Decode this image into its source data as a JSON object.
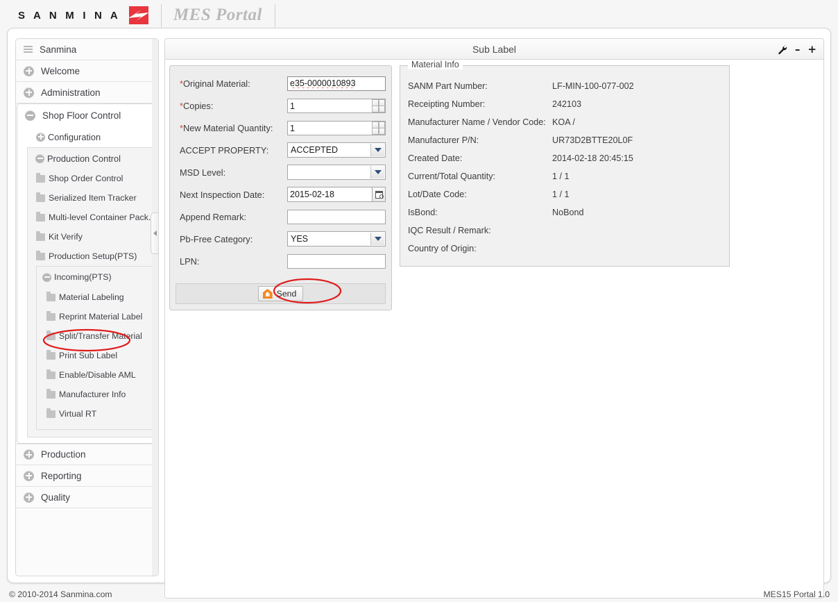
{
  "brand": {
    "word": "S A N M I N A",
    "logo_icon": "sanmina-bolt-logo",
    "logo_color": "#e8353e",
    "portal_title": "MES Portal"
  },
  "sidebar": {
    "top_items": [
      {
        "label": "Sanmina",
        "icon": "list-icon",
        "state": "static"
      },
      {
        "label": "Welcome",
        "icon": "plus-circle-icon",
        "state": "collapsed"
      },
      {
        "label": "Administration",
        "icon": "plus-circle-icon",
        "state": "collapsed"
      }
    ],
    "shop_floor_control": {
      "label": "Shop Floor Control",
      "icon": "minus-circle-icon",
      "state": "expanded",
      "configuration": {
        "label": "Configuration",
        "icon": "plus-circle-icon",
        "state": "collapsed"
      },
      "production_control": {
        "label": "Production Control",
        "icon": "minus-circle-icon",
        "state": "expanded",
        "items": [
          {
            "label": "Shop Order Control",
            "icon": "folder-icon"
          },
          {
            "label": "Serialized Item Tracker",
            "icon": "folder-icon"
          },
          {
            "label": "Multi-level Container Pack.",
            "icon": "folder-icon"
          },
          {
            "label": "Kit Verify",
            "icon": "folder-icon"
          },
          {
            "label": "Production Setup(PTS)",
            "icon": "folder-icon"
          }
        ],
        "incoming": {
          "label": "Incoming(PTS)",
          "icon": "minus-circle-icon",
          "state": "expanded",
          "items": [
            {
              "label": "Material Labeling",
              "icon": "folder-icon",
              "highlighted": false
            },
            {
              "label": "Reprint Material Label",
              "icon": "folder-icon",
              "highlighted": false
            },
            {
              "label": "Split/Transfer Material",
              "icon": "folder-icon",
              "highlighted": false
            },
            {
              "label": "Print Sub Label",
              "icon": "folder-icon",
              "highlighted": true
            },
            {
              "label": "Enable/Disable AML",
              "icon": "folder-icon",
              "highlighted": false
            },
            {
              "label": "Manufacturer Info",
              "icon": "folder-icon",
              "highlighted": false
            },
            {
              "label": "Virtual RT",
              "icon": "folder-icon",
              "highlighted": false
            }
          ]
        }
      }
    },
    "bottom_items": [
      {
        "label": "Production",
        "icon": "plus-circle-icon",
        "state": "collapsed"
      },
      {
        "label": "Reporting",
        "icon": "plus-circle-icon",
        "state": "collapsed"
      },
      {
        "label": "Quality",
        "icon": "plus-circle-icon",
        "state": "collapsed"
      }
    ],
    "collapse_handle_icon": "chevron-left-icon"
  },
  "content": {
    "title": "Sub Label",
    "tools": [
      {
        "name": "wrench-icon",
        "glyph": "\u0001"
      },
      {
        "name": "minimize-icon",
        "glyph": "–"
      },
      {
        "name": "maximize-icon",
        "glyph": "+"
      }
    ]
  },
  "form": {
    "fields": {
      "original_material": {
        "label": "Original Material:",
        "required": true,
        "value": "e35-0000010893",
        "placeholder": "",
        "focused": true,
        "spellcheck_error": true
      },
      "copies": {
        "label": "Copies:",
        "required": true,
        "value": "1",
        "control": "spinner"
      },
      "new_material_quantity": {
        "label": "New Material Quantity:",
        "required": true,
        "value": "1",
        "control": "spinner"
      },
      "accept_property": {
        "label": "ACCEPT PROPERTY:",
        "required": false,
        "value": "ACCEPTED",
        "control": "select"
      },
      "msd_level": {
        "label": "MSD Level:",
        "required": false,
        "value": "",
        "control": "select"
      },
      "next_inspection_date": {
        "label": "Next Inspection Date:",
        "required": false,
        "value": "2015-02-18",
        "control": "date",
        "picker_icon": "calendar-icon"
      },
      "append_remark": {
        "label": "Append Remark:",
        "required": false,
        "value": "",
        "placeholder": ""
      },
      "pb_free_category": {
        "label": "Pb-Free Category:",
        "required": false,
        "value": "YES",
        "control": "select"
      },
      "lpn": {
        "label": "LPN:",
        "required": false,
        "value": "",
        "placeholder": ""
      }
    },
    "submit": {
      "label": "Send",
      "icon": "send-pentagon-icon",
      "icon_color": "#f08a24",
      "highlighted": true
    }
  },
  "material_info": {
    "legend": "Material Info",
    "rows": [
      {
        "label": "SANM Part Number:",
        "value": "LF-MIN-100-077-002"
      },
      {
        "label": "Receipting Number:",
        "value": "242103"
      },
      {
        "label": "Manufacturer Name / Vendor Code:",
        "value": "KOA /"
      },
      {
        "label": "Manufacturer P/N:",
        "value": "UR73D2BTTE20L0F"
      },
      {
        "label": "Created Date:",
        "value": "2014-02-18 20:45:15"
      },
      {
        "label": "Current/Total Quantity:",
        "value": "1 / 1"
      },
      {
        "label": "Lot/Date Code:",
        "value": "1 / 1"
      },
      {
        "label": "IsBond:",
        "value": "NoBond"
      },
      {
        "label": "IQC Result / Remark:",
        "value": ""
      },
      {
        "label": "Country of Origin:",
        "value": ""
      }
    ]
  },
  "annotations": {
    "color": "#e01b1b",
    "shapes": [
      {
        "name": "print-sub-label-highlight",
        "target": "Print Sub Label"
      },
      {
        "name": "send-button-highlight",
        "target": "Send"
      }
    ]
  },
  "footer": {
    "left": "© 2010-2014 Sanmina.com",
    "right": "MES15 Portal 1.0"
  }
}
